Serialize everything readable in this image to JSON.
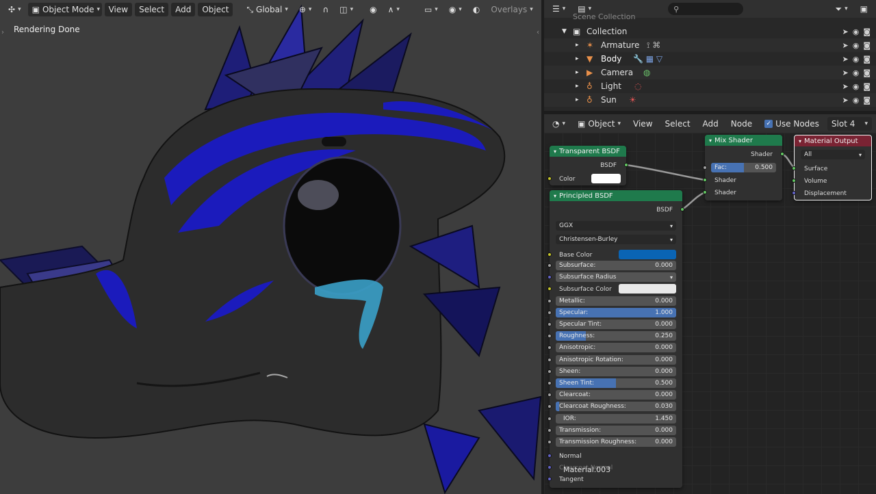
{
  "viewport": {
    "mode": "Object Mode",
    "menus": [
      "View",
      "Select",
      "Add",
      "Object"
    ],
    "orientation": "Global",
    "overlays": "Overlays",
    "status": "Rendering Done"
  },
  "outliner": {
    "root": "Scene Collection",
    "collection": "Collection",
    "items": [
      {
        "name": "Armature"
      },
      {
        "name": "Body"
      },
      {
        "name": "Camera"
      },
      {
        "name": "Light"
      },
      {
        "name": "Sun"
      }
    ]
  },
  "node_editor": {
    "context": "Object",
    "menus": [
      "View",
      "Select",
      "Add",
      "Node"
    ],
    "use_nodes": "Use Nodes",
    "slot": "Slot 4",
    "material_name": "Material.003",
    "transparent": {
      "title": "Transparent BSDF",
      "output": "BSDF",
      "color_label": "Color",
      "color": "#ffffff"
    },
    "mix": {
      "title": "Mix Shader",
      "output": "Shader",
      "fac_label": "Fac:",
      "fac": "0.500",
      "in1": "Shader",
      "in2": "Shader"
    },
    "output": {
      "title": "Material Output",
      "target": "All",
      "inputs": [
        "Surface",
        "Volume",
        "Displacement"
      ]
    },
    "principled": {
      "title": "Principled BSDF",
      "output": "BSDF",
      "distribution": "GGX",
      "subsurface_method": "Christensen-Burley",
      "base_color_label": "Base Color",
      "base_color": "#0a64b4",
      "subsurface_color_label": "Subsurface Color",
      "subsurface_color": "#e8e8e8",
      "subsurface_radius": "Subsurface Radius",
      "params": [
        {
          "label": "Subsurface:",
          "value": "0.000",
          "fill": 0
        },
        {
          "label": "Metallic:",
          "value": "0.000",
          "fill": 0
        },
        {
          "label": "Specular:",
          "value": "1.000",
          "fill": 1
        },
        {
          "label": "Specular Tint:",
          "value": "0.000",
          "fill": 0
        },
        {
          "label": "Roughness:",
          "value": "0.250",
          "fill": 0.25
        },
        {
          "label": "Anisotropic:",
          "value": "0.000",
          "fill": 0
        },
        {
          "label": "Anisotropic Rotation:",
          "value": "0.000",
          "fill": 0
        },
        {
          "label": "Sheen:",
          "value": "0.000",
          "fill": 0
        },
        {
          "label": "Sheen Tint:",
          "value": "0.500",
          "fill": 0.5
        },
        {
          "label": "Clearcoat:",
          "value": "0.000",
          "fill": 0
        },
        {
          "label": "Clearcoat Roughness:",
          "value": "0.030",
          "fill": 0.03
        },
        {
          "label": "IOR:",
          "value": "1.450",
          "fill": 0
        },
        {
          "label": "Transmission:",
          "value": "0.000",
          "fill": 0
        },
        {
          "label": "Transmission Roughness:",
          "value": "0.000",
          "fill": 0
        }
      ],
      "vectors": [
        "Normal",
        "Clearcoat Normal",
        "Tangent"
      ]
    }
  },
  "colors": {
    "accent": "#4772b3",
    "node_header_green": "#1f7a4c",
    "node_header_red": "#7a2333",
    "dragon_blue": "#1a1acc"
  }
}
